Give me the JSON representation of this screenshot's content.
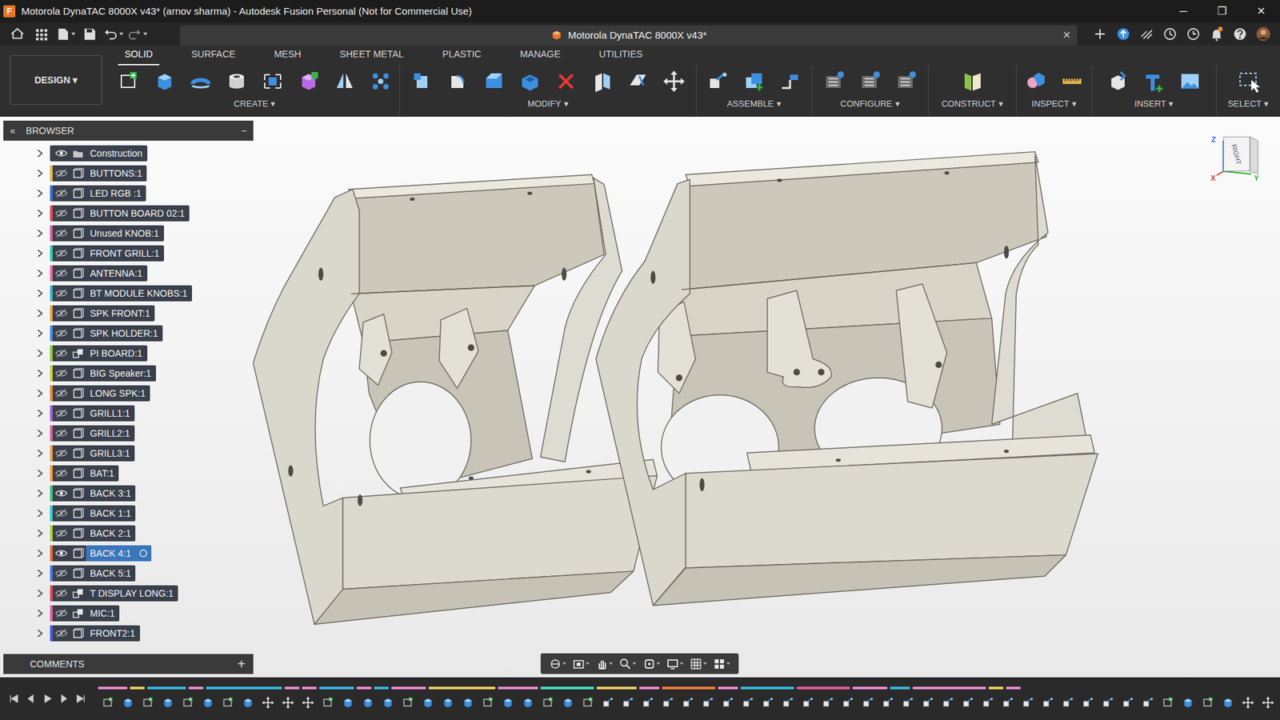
{
  "window": {
    "title": "Motorola DynaTAC 8000X v43* (arnov sharma) - Autodesk Fusion Personal (Not for Commercial Use)",
    "app_icon": "F",
    "controls": [
      "─",
      "❐",
      "✕"
    ]
  },
  "document_tab": {
    "title": "Motorola DynaTAC 8000X v43*",
    "close": "×"
  },
  "notifications": {
    "unread": true
  },
  "workspace": {
    "label": "DESIGN",
    "caret": "▾"
  },
  "toolbar_tabs": [
    {
      "label": "SOLID",
      "selected": true
    },
    {
      "label": "SURFACE",
      "selected": false
    },
    {
      "label": "MESH",
      "selected": false
    },
    {
      "label": "SHEET METAL",
      "selected": false
    },
    {
      "label": "PLASTIC",
      "selected": false
    },
    {
      "label": "MANAGE",
      "selected": false
    },
    {
      "label": "UTILITIES",
      "selected": false
    }
  ],
  "tool_groups": [
    {
      "label": "CREATE",
      "caret": "▾"
    },
    {
      "label": "MODIFY",
      "caret": "▾"
    },
    {
      "label": "ASSEMBLE",
      "caret": "▾"
    },
    {
      "label": "CONFIGURE",
      "caret": "▾"
    },
    {
      "label": "CONSTRUCT",
      "caret": "▾"
    },
    {
      "label": "INSPECT",
      "caret": "▾"
    },
    {
      "label": "INSERT",
      "caret": "▾"
    },
    {
      "label": "SELECT",
      "caret": "▾"
    }
  ],
  "browser": {
    "title": "BROWSER",
    "collapse": "«",
    "minimize": "−",
    "items": [
      {
        "label": "Construction",
        "kind": "folder",
        "visible": true,
        "selected": false
      },
      {
        "label": "BUTTONS:1",
        "kind": "component",
        "visible": false,
        "selected": false,
        "color": "#e8b04a"
      },
      {
        "label": "LED RGB :1",
        "kind": "component",
        "visible": false,
        "selected": false,
        "color": "#3d6fd0"
      },
      {
        "label": "BUTTON BOARD 02:1",
        "kind": "component",
        "visible": false,
        "selected": false,
        "color": "#e04b5a"
      },
      {
        "label": "Unused KNOB:1",
        "kind": "component",
        "visible": false,
        "selected": false,
        "color": "#d45fa0"
      },
      {
        "label": "FRONT GRILL:1",
        "kind": "component",
        "visible": false,
        "selected": false,
        "color": "#36c9b0"
      },
      {
        "label": "ANTENNA:1",
        "kind": "component",
        "visible": false,
        "selected": false,
        "color": "#e86aa0"
      },
      {
        "label": "BT MODULE KNOBS:1",
        "kind": "component",
        "visible": false,
        "selected": false,
        "color": "#3ab8c8"
      },
      {
        "label": "SPK FRONT:1",
        "kind": "component",
        "visible": false,
        "selected": false,
        "color": "#e8a040"
      },
      {
        "label": "SPK HOLDER:1",
        "kind": "component",
        "visible": false,
        "selected": false,
        "color": "#4a8fe0"
      },
      {
        "label": "PI BOARD:1",
        "kind": "assembly",
        "visible": false,
        "selected": false,
        "color": "#8ac840"
      },
      {
        "label": "BIG Speaker:1",
        "kind": "component",
        "visible": false,
        "selected": false,
        "color": "#c8d040"
      },
      {
        "label": "LONG SPK:1",
        "kind": "component",
        "visible": false,
        "selected": false,
        "color": "#e88a30"
      },
      {
        "label": "GRILL1:1",
        "kind": "component",
        "visible": false,
        "selected": false,
        "color": "#a060d8"
      },
      {
        "label": "GRILL2:1",
        "kind": "component",
        "visible": false,
        "selected": false,
        "color": "#d860a0"
      },
      {
        "label": "GRILL3:1",
        "kind": "component",
        "visible": false,
        "selected": false,
        "color": "#e8a050"
      },
      {
        "label": "BAT:1",
        "kind": "component",
        "visible": false,
        "selected": false,
        "color": "#f0a040"
      },
      {
        "label": "BACK 3:1",
        "kind": "component",
        "visible": true,
        "selected": false,
        "color": "#40c080"
      },
      {
        "label": "BACK 1:1",
        "kind": "component",
        "visible": false,
        "selected": false,
        "color": "#38c8c8"
      },
      {
        "label": "BACK 2:1",
        "kind": "component",
        "visible": false,
        "selected": false,
        "color": "#a8d040"
      },
      {
        "label": "BACK 4:1",
        "kind": "component",
        "visible": true,
        "selected": true,
        "color": "#e86840"
      },
      {
        "label": "BACK 5:1",
        "kind": "component",
        "visible": false,
        "selected": false,
        "color": "#4a78e0"
      },
      {
        "label": "T DISPLAY LONG:1",
        "kind": "assembly",
        "visible": false,
        "selected": false,
        "color": "#e04858"
      },
      {
        "label": "MIC:1",
        "kind": "assembly",
        "visible": false,
        "selected": false,
        "color": "#e060a0"
      },
      {
        "label": "FRONT2:1",
        "kind": "component",
        "visible": false,
        "selected": false,
        "color": "#4060e0"
      }
    ]
  },
  "comments": {
    "label": "COMMENTS",
    "add": "+"
  },
  "viewcube": {
    "face": "RIGHT",
    "axes": [
      "Z",
      "X",
      "Y"
    ]
  }
}
